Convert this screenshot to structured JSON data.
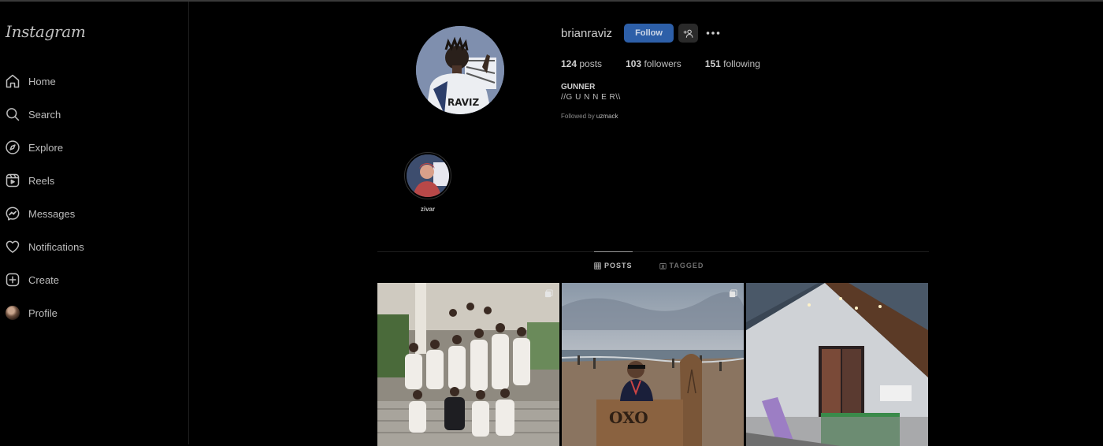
{
  "app": {
    "logo_text": "Instagram"
  },
  "sidebar": {
    "items": [
      {
        "label": "Home",
        "icon": "home-icon"
      },
      {
        "label": "Search",
        "icon": "search-icon"
      },
      {
        "label": "Explore",
        "icon": "compass-icon"
      },
      {
        "label": "Reels",
        "icon": "reels-icon"
      },
      {
        "label": "Messages",
        "icon": "messenger-icon"
      },
      {
        "label": "Notifications",
        "icon": "heart-icon"
      },
      {
        "label": "Create",
        "icon": "plus-square-icon"
      },
      {
        "label": "Profile",
        "icon": "avatar"
      }
    ]
  },
  "profile": {
    "username": "brianraviz",
    "follow_label": "Follow",
    "posts_count": "124",
    "posts_label": "posts",
    "followers_count": "103",
    "followers_label": "followers",
    "following_count": "151",
    "following_label": "following",
    "bio_name": "GUNNER",
    "bio_line": "//G U N N E R\\\\",
    "followed_by_prefix": "Followed by",
    "followed_by_user": "uzmack"
  },
  "highlights": [
    {
      "label": "zivar"
    }
  ],
  "tabs": [
    {
      "label": "POSTS",
      "active": true,
      "icon": "grid-icon"
    },
    {
      "label": "TAGGED",
      "active": false,
      "icon": "tag-icon"
    }
  ],
  "posts": [
    {
      "icon": "multiple-posts-icon"
    },
    {
      "icon": "multiple-posts-icon"
    },
    {
      "icon": ""
    }
  ],
  "colors": {
    "follow_button": "#2d5fa8",
    "background": "#000000"
  }
}
